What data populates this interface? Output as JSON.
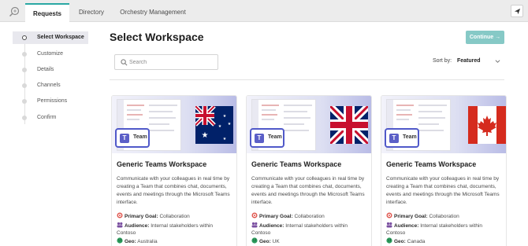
{
  "topbar": {
    "tabs": [
      {
        "label": "Requests",
        "active": true
      },
      {
        "label": "Directory",
        "active": false
      },
      {
        "label": "Orchestry Management",
        "active": false
      }
    ]
  },
  "sidebar": {
    "steps": [
      {
        "label": "Select Workspace",
        "active": true
      },
      {
        "label": "Customize",
        "active": false
      },
      {
        "label": "Details",
        "active": false
      },
      {
        "label": "Channels",
        "active": false
      },
      {
        "label": "Permissions",
        "active": false
      },
      {
        "label": "Confirm",
        "active": false
      }
    ]
  },
  "main": {
    "title": "Select Workspace",
    "continue_label": "Continue",
    "search_placeholder": "Search",
    "sort_label": "Sort by:",
    "sort_value": "Featured"
  },
  "cards": [
    {
      "title": "Generic Teams Workspace",
      "description": "Communicate with your colleagues in real time by creating a Team that combines chat, documents, events and meetings through the Microsoft Teams interface.",
      "badge_label": "Team",
      "goal_label": "Primary Goal:",
      "goal_value": "Collaboration",
      "audience_label": "Audience:",
      "audience_value": "Internal stakeholders within Contoso",
      "geo_label": "Geo:",
      "geo_value": "Australia",
      "flag": "australia-flag"
    },
    {
      "title": "Generic Teams Workspace",
      "description": "Communicate with your colleagues in real time by creating a Team that combines chat, documents, events and meetings through the Microsoft Teams interface.",
      "badge_label": "Team",
      "goal_label": "Primary Goal:",
      "goal_value": "Collaboration",
      "audience_label": "Audience:",
      "audience_value": "Internal stakeholders within Contoso",
      "geo_label": "Geo:",
      "geo_value": "UK",
      "flag": "uk-flag"
    },
    {
      "title": "Generic Teams Workspace",
      "description": "Communicate with your colleagues in real time by creating a Team that combines chat, documents, events and meetings through the Microsoft Teams interface.",
      "badge_label": "Team",
      "goal_label": "Primary Goal:",
      "goal_value": "Collaboration",
      "audience_label": "Audience:",
      "audience_value": "Internal stakeholders within Contoso",
      "geo_label": "Geo:",
      "geo_value": "Canada",
      "flag": "canada-flag"
    }
  ],
  "colors": {
    "accent": "#2aa8a4",
    "continue_button": "#86c9c6",
    "teams_purple": "#5b5fc7"
  }
}
